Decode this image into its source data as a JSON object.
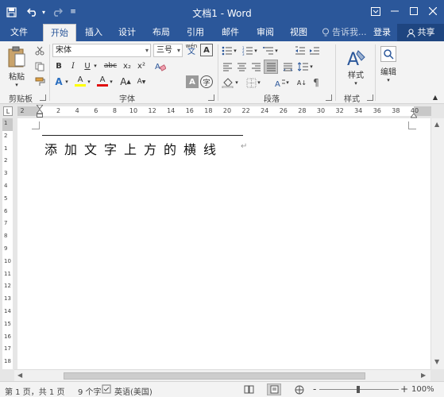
{
  "window": {
    "title": "文档1 - Word",
    "accent": "#2b579a"
  },
  "quick_access": {
    "save_icon": "save-icon",
    "undo_icon": "undo-icon",
    "redo_icon": "redo-icon",
    "customize_icon": "customize-qat-icon"
  },
  "tabs": [
    {
      "label": "文件"
    },
    {
      "label": "开始"
    },
    {
      "label": "插入"
    },
    {
      "label": "设计"
    },
    {
      "label": "布局"
    },
    {
      "label": "引用"
    },
    {
      "label": "邮件"
    },
    {
      "label": "审阅"
    },
    {
      "label": "视图"
    }
  ],
  "active_tab": "开始",
  "tellme": "告诉我...",
  "login": "登录",
  "share": "共享",
  "ribbon": {
    "clipboard": {
      "paste_label": "粘贴",
      "group_label": "剪贴板"
    },
    "font": {
      "font_name": "宋体",
      "font_size": "三号",
      "wen_label": "wén",
      "wen_char": "文",
      "bold": "B",
      "italic": "I",
      "underline": "U",
      "strike": "abc",
      "subscript": "x₂",
      "superscript": "x²",
      "highlight_letter": "A",
      "font_color_letter": "A",
      "char_shading": "A",
      "enclosed_char": "字",
      "group_label": "字体"
    },
    "paragraph": {
      "group_label": "段落"
    },
    "styles": {
      "styles_label": "样式",
      "group_label": "样式"
    },
    "editing": {
      "edit_label": "编辑"
    }
  },
  "ruler": {
    "h_ticks": [
      "2",
      "2",
      "4",
      "6",
      "8",
      "10",
      "12",
      "14",
      "16",
      "18",
      "20",
      "22",
      "24",
      "26",
      "28",
      "30",
      "32",
      "34",
      "36",
      "38",
      "40"
    ],
    "v_ticks": [
      "1",
      "2",
      "1",
      "2",
      "3",
      "4",
      "5",
      "6",
      "7",
      "8",
      "9",
      "10",
      "11",
      "12",
      "13",
      "14",
      "15",
      "16",
      "17",
      "18"
    ]
  },
  "document": {
    "text": "添加文字上方的横线",
    "paragraph_mark": "↵"
  },
  "status": {
    "page": "第 1 页，共 1 页",
    "words": "9 个字",
    "language": "英语(美国)",
    "zoom": "100%",
    "zoom_out": "-",
    "zoom_in": "+"
  }
}
